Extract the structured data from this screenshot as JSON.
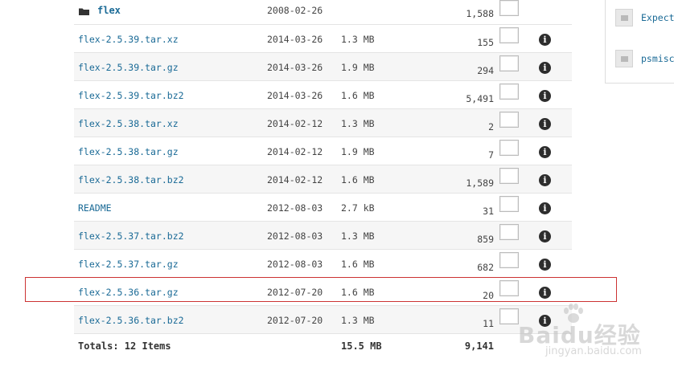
{
  "folder": {
    "name": "flex",
    "date": "2008-02-26",
    "count": "1,588"
  },
  "files": [
    {
      "name": "flex-2.5.39.tar.xz",
      "date": "2014-03-26",
      "size": "1.3 MB",
      "count": "155"
    },
    {
      "name": "flex-2.5.39.tar.gz",
      "date": "2014-03-26",
      "size": "1.9 MB",
      "count": "294"
    },
    {
      "name": "flex-2.5.39.tar.bz2",
      "date": "2014-03-26",
      "size": "1.6 MB",
      "count": "5,491"
    },
    {
      "name": "flex-2.5.38.tar.xz",
      "date": "2014-02-12",
      "size": "1.3 MB",
      "count": "2"
    },
    {
      "name": "flex-2.5.38.tar.gz",
      "date": "2014-02-12",
      "size": "1.9 MB",
      "count": "7"
    },
    {
      "name": "flex-2.5.38.tar.bz2",
      "date": "2014-02-12",
      "size": "1.6 MB",
      "count": "1,589"
    },
    {
      "name": "README",
      "date": "2012-08-03",
      "size": "2.7 kB",
      "count": "31"
    },
    {
      "name": "flex-2.5.37.tar.bz2",
      "date": "2012-08-03",
      "size": "1.3 MB",
      "count": "859"
    },
    {
      "name": "flex-2.5.37.tar.gz",
      "date": "2012-08-03",
      "size": "1.6 MB",
      "count": "682"
    },
    {
      "name": "flex-2.5.36.tar.gz",
      "date": "2012-07-20",
      "size": "1.6 MB",
      "count": "20"
    },
    {
      "name": "flex-2.5.36.tar.bz2",
      "date": "2012-07-20",
      "size": "1.3 MB",
      "count": "11"
    }
  ],
  "info_glyph": "i",
  "totals": {
    "label": "Totals: 12 Items",
    "size": "15.5 MB",
    "count": "9,141"
  },
  "side_panel": {
    "items": [
      {
        "label": "Expect"
      },
      {
        "label": "psmisc"
      }
    ]
  },
  "watermark": {
    "logo": "Baidu经验",
    "url": "jingyan.baidu.com"
  },
  "colors": {
    "link": "#1a6a96",
    "highlight": "#cc3333",
    "alt_row": "#f6f6f6"
  }
}
